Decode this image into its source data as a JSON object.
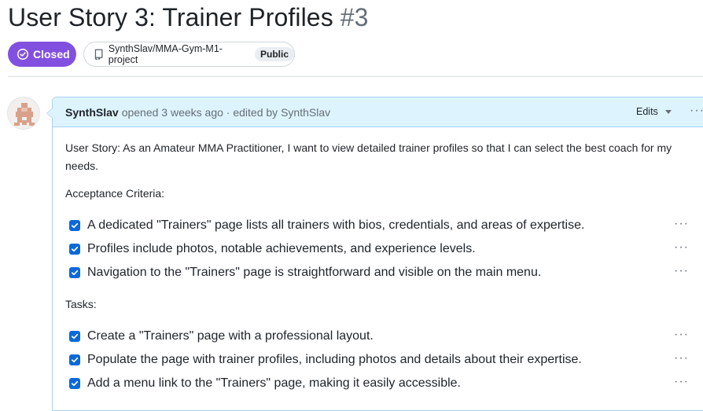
{
  "issue": {
    "title": "User Story 3: Trainer Profiles",
    "number": "#3",
    "status": "Closed",
    "repo": "SynthSlav/MMA-Gym-M1-project",
    "visibility": "Public"
  },
  "comment": {
    "author": "SynthSlav",
    "meta": "opened 3 weeks ago · edited by SynthSlav",
    "edits_label": "Edits",
    "more_label": "···",
    "story": "User Story: As an Amateur MMA Practitioner, I want to view detailed trainer profiles so that I can select the best coach for my needs.",
    "acceptance_heading": "Acceptance Criteria:",
    "acceptance": [
      {
        "text": "A dedicated \"Trainers\" page lists all trainers with bios, credentials, and areas of expertise.",
        "checked": true
      },
      {
        "text": "Profiles include photos, notable achievements, and experience levels.",
        "checked": true
      },
      {
        "text": "Navigation to the \"Trainers\" page is straightforward and visible on the main menu.",
        "checked": true
      }
    ],
    "tasks_heading": "Tasks:",
    "tasks": [
      {
        "text": "Create a \"Trainers\" page with a professional layout.",
        "checked": true
      },
      {
        "text": "Populate the page with trainer profiles, including photos and details about their expertise.",
        "checked": true
      },
      {
        "text": "Add a menu link to the \"Trainers\" page, making it easily accessible.",
        "checked": true
      }
    ]
  },
  "colors": {
    "closed_badge": "#8250df",
    "checkbox": "#0969da",
    "comment_header_bg": "#ddf4ff",
    "comment_border": "#a7d1f5"
  },
  "icons": {
    "status": "issue-closed-icon",
    "repo": "repo-icon",
    "checkbox": "checkbox-checked-icon",
    "more": "kebab-horizontal-icon"
  }
}
